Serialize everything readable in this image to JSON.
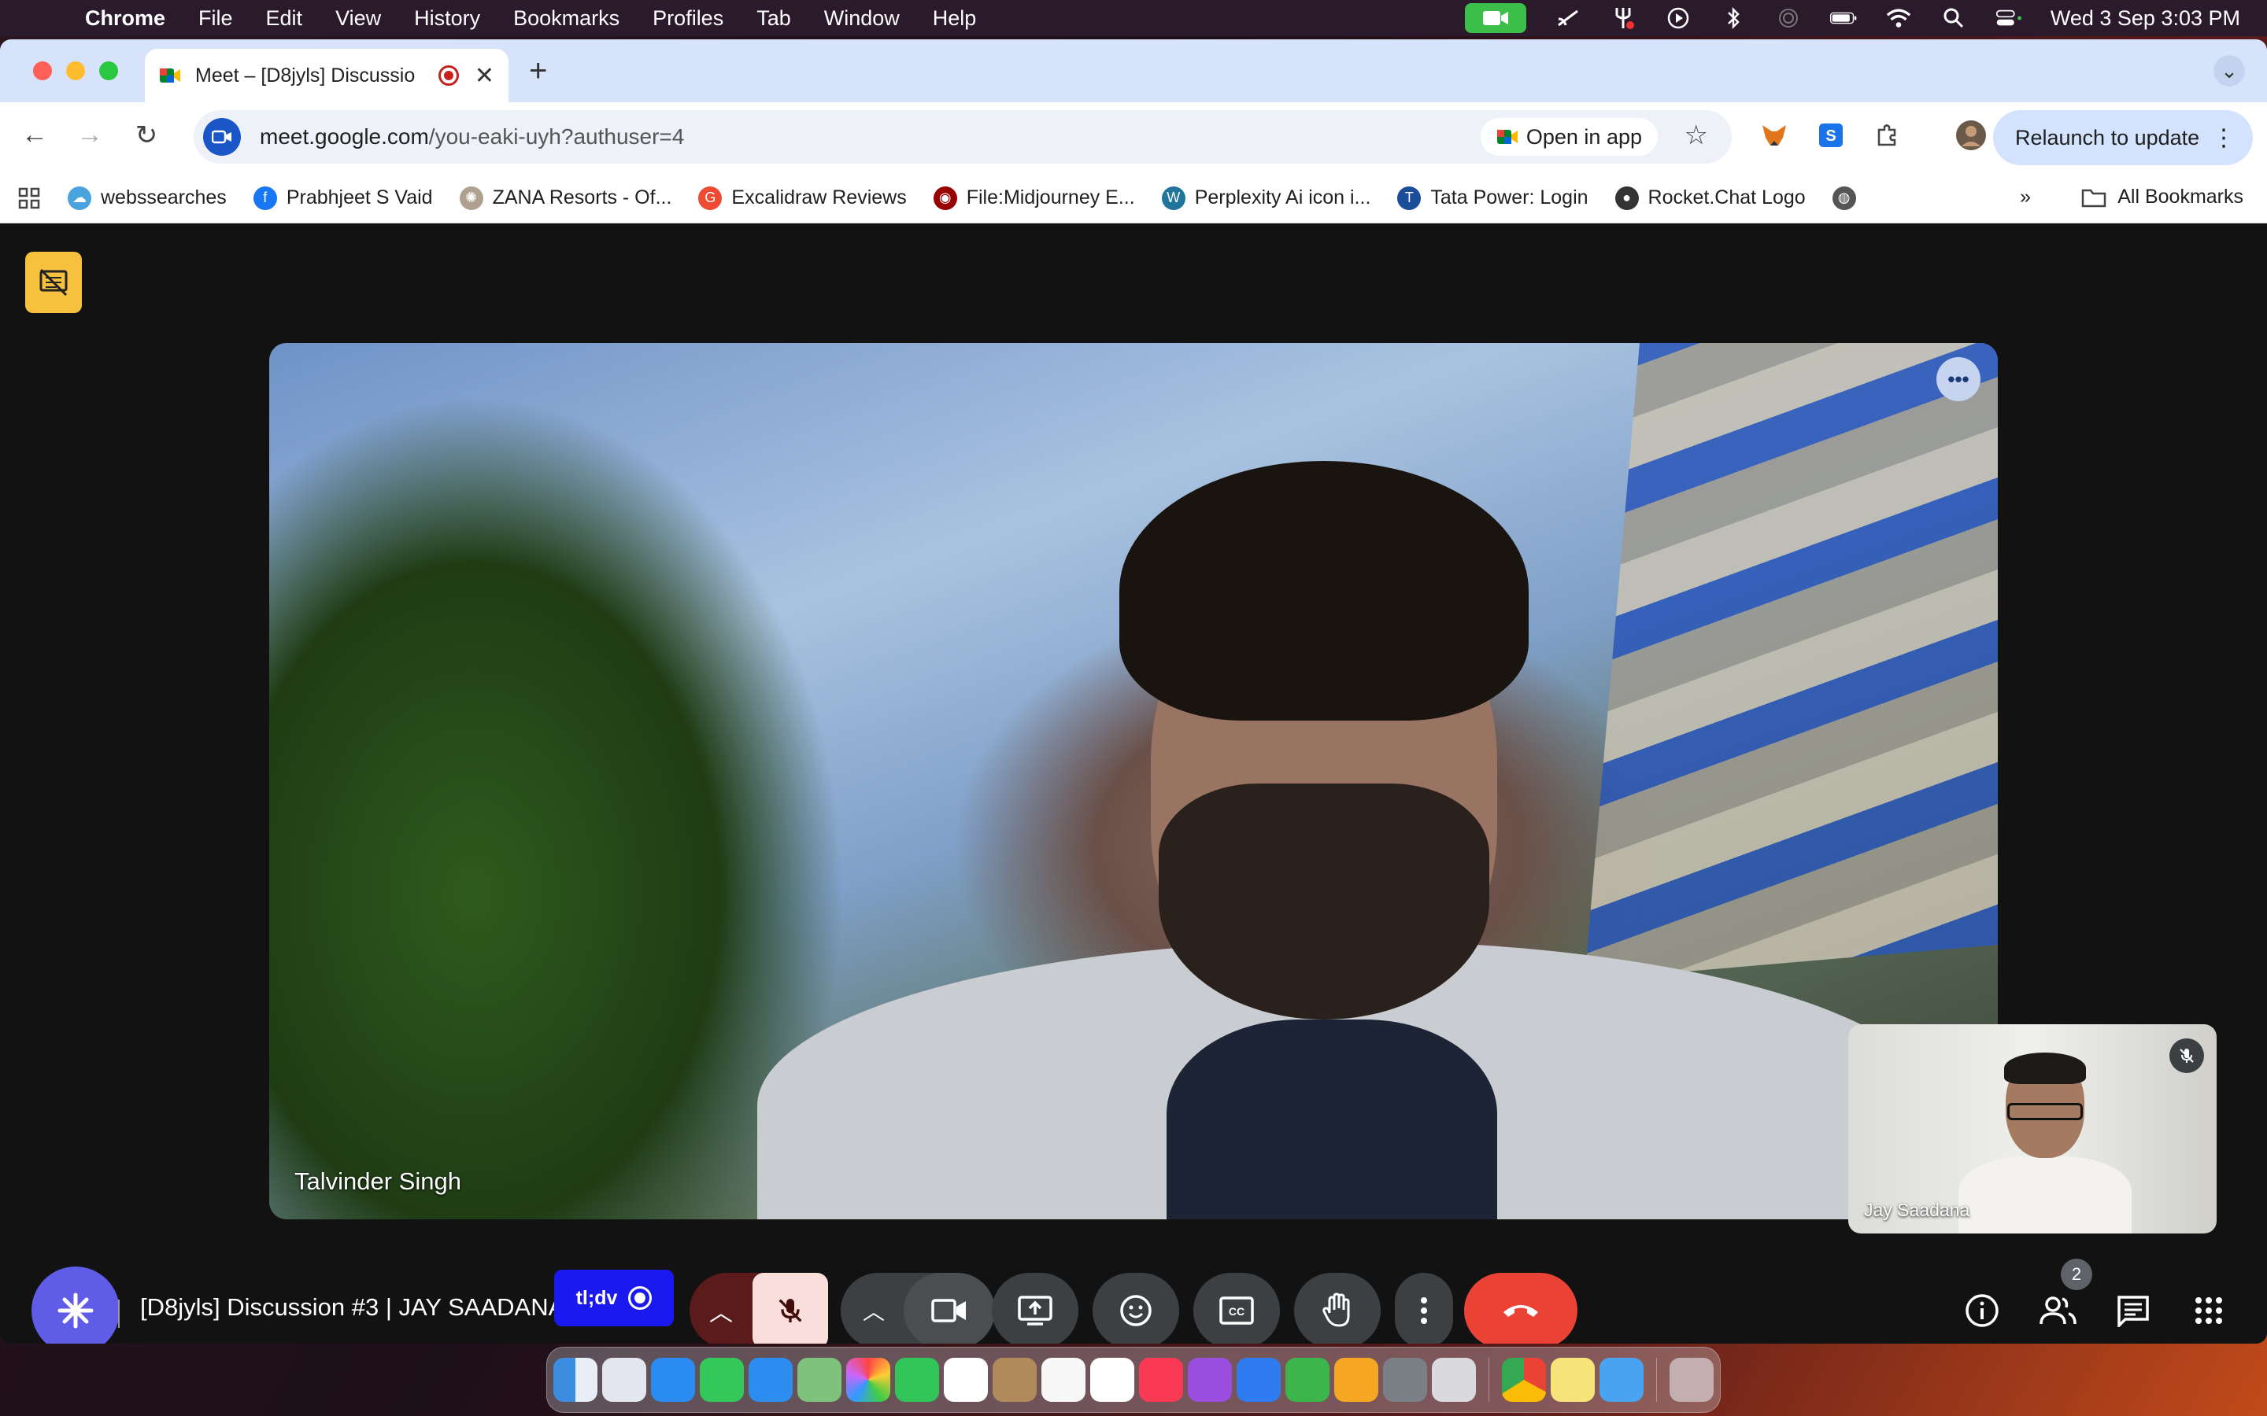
{
  "menubar": {
    "app": "Chrome",
    "items": [
      "File",
      "Edit",
      "View",
      "History",
      "Bookmarks",
      "Profiles",
      "Tab",
      "Window",
      "Help"
    ],
    "clock": "Wed 3 Sep  3:03 PM"
  },
  "tab": {
    "title": "Meet – [D8jyls] Discussio",
    "new_tab": "+",
    "close": "✕"
  },
  "toolbar": {
    "url_host": "meet.google.com",
    "url_path": "/you-eaki-uyh?authuser=4",
    "open_in_app": "Open in app",
    "relaunch": "Relaunch to update"
  },
  "bookmarks": {
    "items": [
      {
        "label": "webssearches",
        "icon": "cloud-icon",
        "color": "#4aa3df"
      },
      {
        "label": "Prabhjeet S Vaid",
        "icon": "facebook-icon",
        "color": "#1877f2"
      },
      {
        "label": "ZANA Resorts - Of...",
        "icon": "zana-icon",
        "color": "#b0a090"
      },
      {
        "label": "Excalidraw Reviews",
        "icon": "g2-icon",
        "color": "#ef4a33"
      },
      {
        "label": "File:Midjourney E...",
        "icon": "wikimedia-icon",
        "color": "#990000"
      },
      {
        "label": "Perplexity Ai icon i...",
        "icon": "wordpress-icon",
        "color": "#21759b"
      },
      {
        "label": "Tata Power: Login",
        "icon": "tata-icon",
        "color": "#1a4d9a"
      },
      {
        "label": "Rocket.Chat Logo",
        "icon": "github-icon",
        "color": "#333333"
      }
    ],
    "overflow": "»",
    "all_bookmarks": "All Bookmarks"
  },
  "meet": {
    "main_participant": "Talvinder Singh",
    "pip_participant": "Jay Saadana",
    "meeting_title": "[D8jyls] Discussion #3 | JAY SAADANA",
    "tldv_label": "tl;dv",
    "participants_count": "2",
    "colors": {
      "end_call": "#ea4335",
      "mic_muted_bg": "#f9dedc",
      "accent": "#8ab4f8"
    }
  }
}
